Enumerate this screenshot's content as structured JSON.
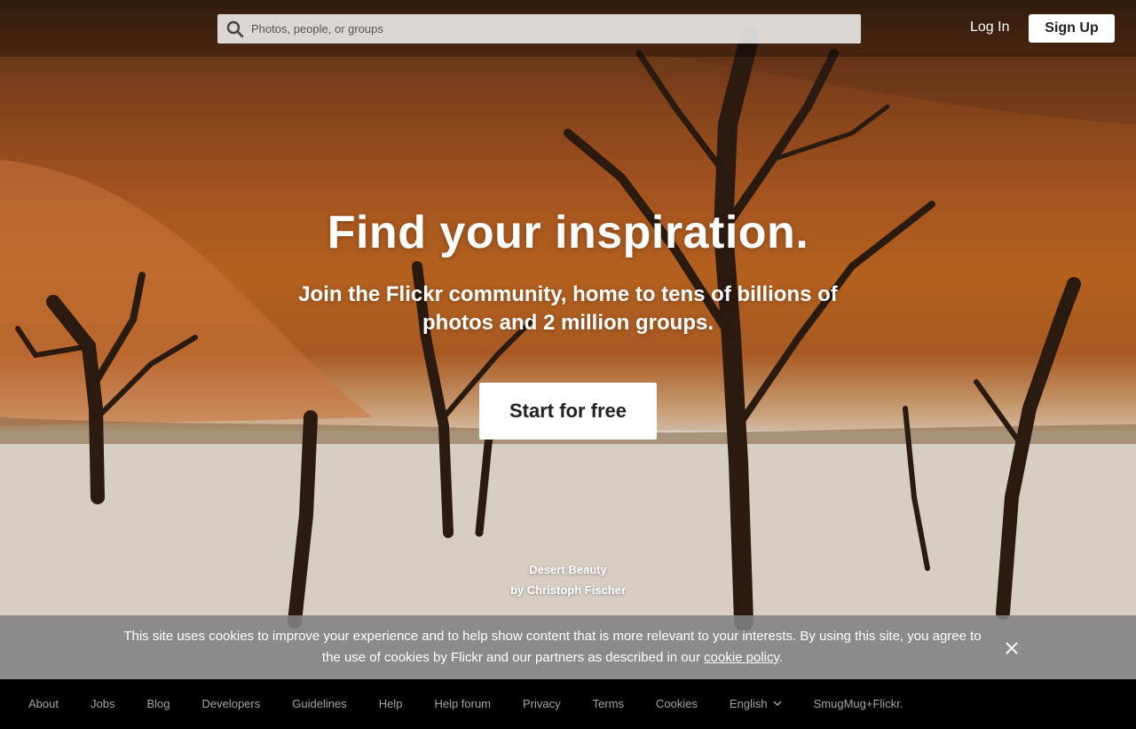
{
  "header": {
    "search_placeholder": "Photos, people, or groups",
    "login_label": "Log In",
    "signup_label": "Sign Up"
  },
  "hero": {
    "headline": "Find your inspiration.",
    "subhead": "Join the Flickr community, home to tens of billions of photos and 2 million groups.",
    "cta_label": "Start for free",
    "photo_title": "Desert Beauty",
    "photo_credit": "by Christoph Fischer"
  },
  "cookie_banner": {
    "text_before": "This site uses cookies to improve your experience and to help show content that is more relevant to your interests. By using this site, you agree to the use of cookies by Flickr and our partners as described in our ",
    "link_label": "cookie policy",
    "text_after": "."
  },
  "footer": {
    "links": [
      "About",
      "Jobs",
      "Blog",
      "Developers",
      "Guidelines",
      "Help",
      "Help forum",
      "Privacy",
      "Terms",
      "Cookies"
    ],
    "language": "English",
    "brand": "SmugMug+Flickr."
  },
  "colors": {
    "dune": "#a3531f",
    "pan": "#d8d0c8",
    "tree": "#2a1a10",
    "footer_bg": "#000000",
    "footer_text": "#a5a5a8"
  }
}
